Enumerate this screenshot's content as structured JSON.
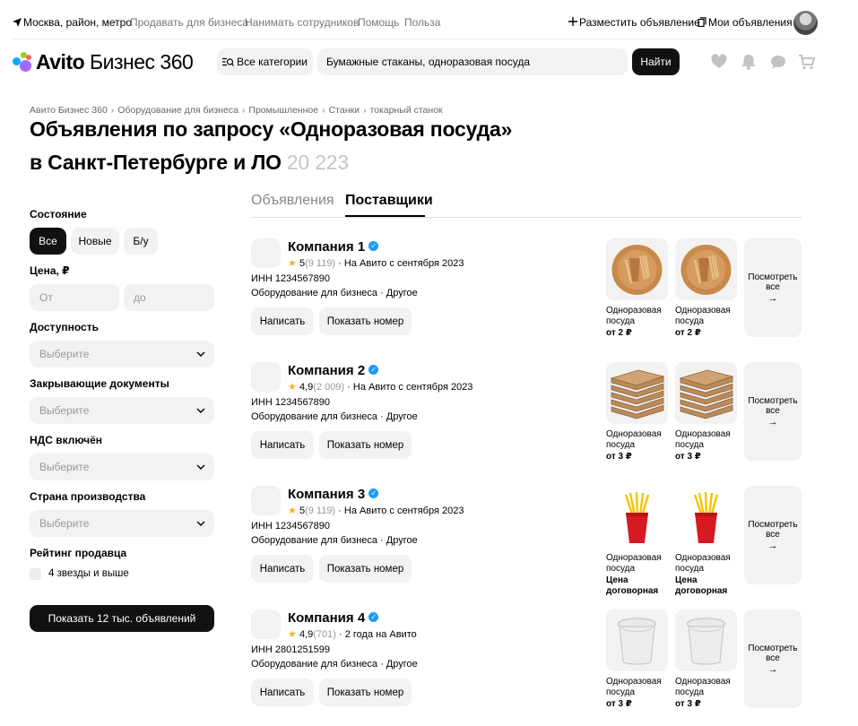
{
  "topbar": {
    "location": "Москва, район, метро",
    "links": [
      "Продавать для бизнеса",
      "Нанимать сотрудников",
      "Помощь",
      "Польза"
    ],
    "post_ad": "Разместить объявление",
    "my_ads": "Мои объявления"
  },
  "header": {
    "logo_brand": "Avito",
    "logo_product": "Бизнес 360",
    "categories_label": "Все категории",
    "search_value": "Бумажные стаканы, одноразовая посуда",
    "find_label": "Найти"
  },
  "breadcrumbs": [
    "Авито Бизнес 360",
    "Оборудование для бизнеса",
    "Промышленное",
    "Станки",
    "токарный станок"
  ],
  "title": {
    "line1": "Объявления по запросу «Одноразовая посуда»",
    "line2": "в Санкт-Петербурге и ЛО",
    "count": "20 223"
  },
  "filters": {
    "condition_label": "Состояние",
    "condition_options": [
      "Все",
      "Новые",
      "Б/у"
    ],
    "price_label": "Цена, ₽",
    "price_from": "От",
    "price_to": "до",
    "availability_label": "Доступность",
    "availability_value": "Выберите",
    "closing_docs_label": "Закрывающие документы",
    "closing_docs_value": "Выберите",
    "vat_label": "НДС включён",
    "vat_value": "Выберите",
    "country_label": "Страна производства",
    "country_value": "Выберите",
    "seller_rating_label": "Рейтинг продавца",
    "seller_rating_option": "4 звезды и выше",
    "show_button": "Показать 12 тыс. объявлений"
  },
  "tabs": [
    "Объявления",
    "Поставщики"
  ],
  "suppliers": [
    {
      "name": "Компания 1",
      "rating": "5",
      "reviews": "(9 119)",
      "since": "На Авито с сентября 2023",
      "inn": "ИНН 1234567890",
      "category": "Оборудование для бизнеса · Другое",
      "write": "Написать",
      "show_phone": "Показать номер",
      "products": [
        {
          "name": "Одноразовая посуда",
          "price": "от 2 ₽",
          "image": "plate-set-image"
        },
        {
          "name": "Одноразовая посуда",
          "price": "от 2 ₽",
          "image": "plate-set-image"
        }
      ],
      "more": "Посмотреть все"
    },
    {
      "name": "Компания 2",
      "rating": "4,9",
      "reviews": "(2 009)",
      "since": "На Авито с сентября 2023",
      "inn": "ИНН 1234567890",
      "category": "Оборудование для бизнеса · Другое",
      "write": "Написать",
      "show_phone": "Показать номер",
      "products": [
        {
          "name": "Одноразовая посуда",
          "price": "от 3 ₽",
          "image": "pizza-boxes-image"
        },
        {
          "name": "Одноразовая посуда",
          "price": "от 3 ₽",
          "image": "pizza-boxes-image"
        }
      ],
      "more": "Посмотреть все"
    },
    {
      "name": "Компания 3",
      "rating": "5",
      "reviews": "(9 119)",
      "since": "На Авито с сентября 2023",
      "inn": "ИНН 1234567890",
      "category": "Оборудование для бизнеса · Другое",
      "write": "Написать",
      "show_phone": "Показать номер",
      "products": [
        {
          "name": "Одноразовая посуда",
          "price": "Цена договорная",
          "image": "cup-forks-image"
        },
        {
          "name": "Одноразовая посуда",
          "price": "Цена договорная",
          "image": "cup-forks-image"
        }
      ],
      "more": "Посмотреть все"
    },
    {
      "name": "Компания 4",
      "rating": "4,9",
      "reviews": "(701)",
      "since": "2 года на Авито",
      "inn": "ИНН 2801251599",
      "category": "Оборудование для бизнеса · Другое",
      "write": "Написать",
      "show_phone": "Показать номер",
      "products": [
        {
          "name": "Одноразовая посуда",
          "price": "от 3 ₽",
          "image": "soup-container-image"
        },
        {
          "name": "Одноразовая посуда",
          "price": "от 3 ₽",
          "image": "soup-container-image"
        }
      ],
      "more": "Посмотреть все"
    }
  ],
  "colors": {
    "accent_dark": "#111111",
    "surface": "#f2f2f2",
    "verified_blue": "#1a9bff",
    "star_yellow": "#ffb021",
    "logo_dots": [
      "#00aaff",
      "#97cf26",
      "#a169f7",
      "#ff6163"
    ]
  }
}
